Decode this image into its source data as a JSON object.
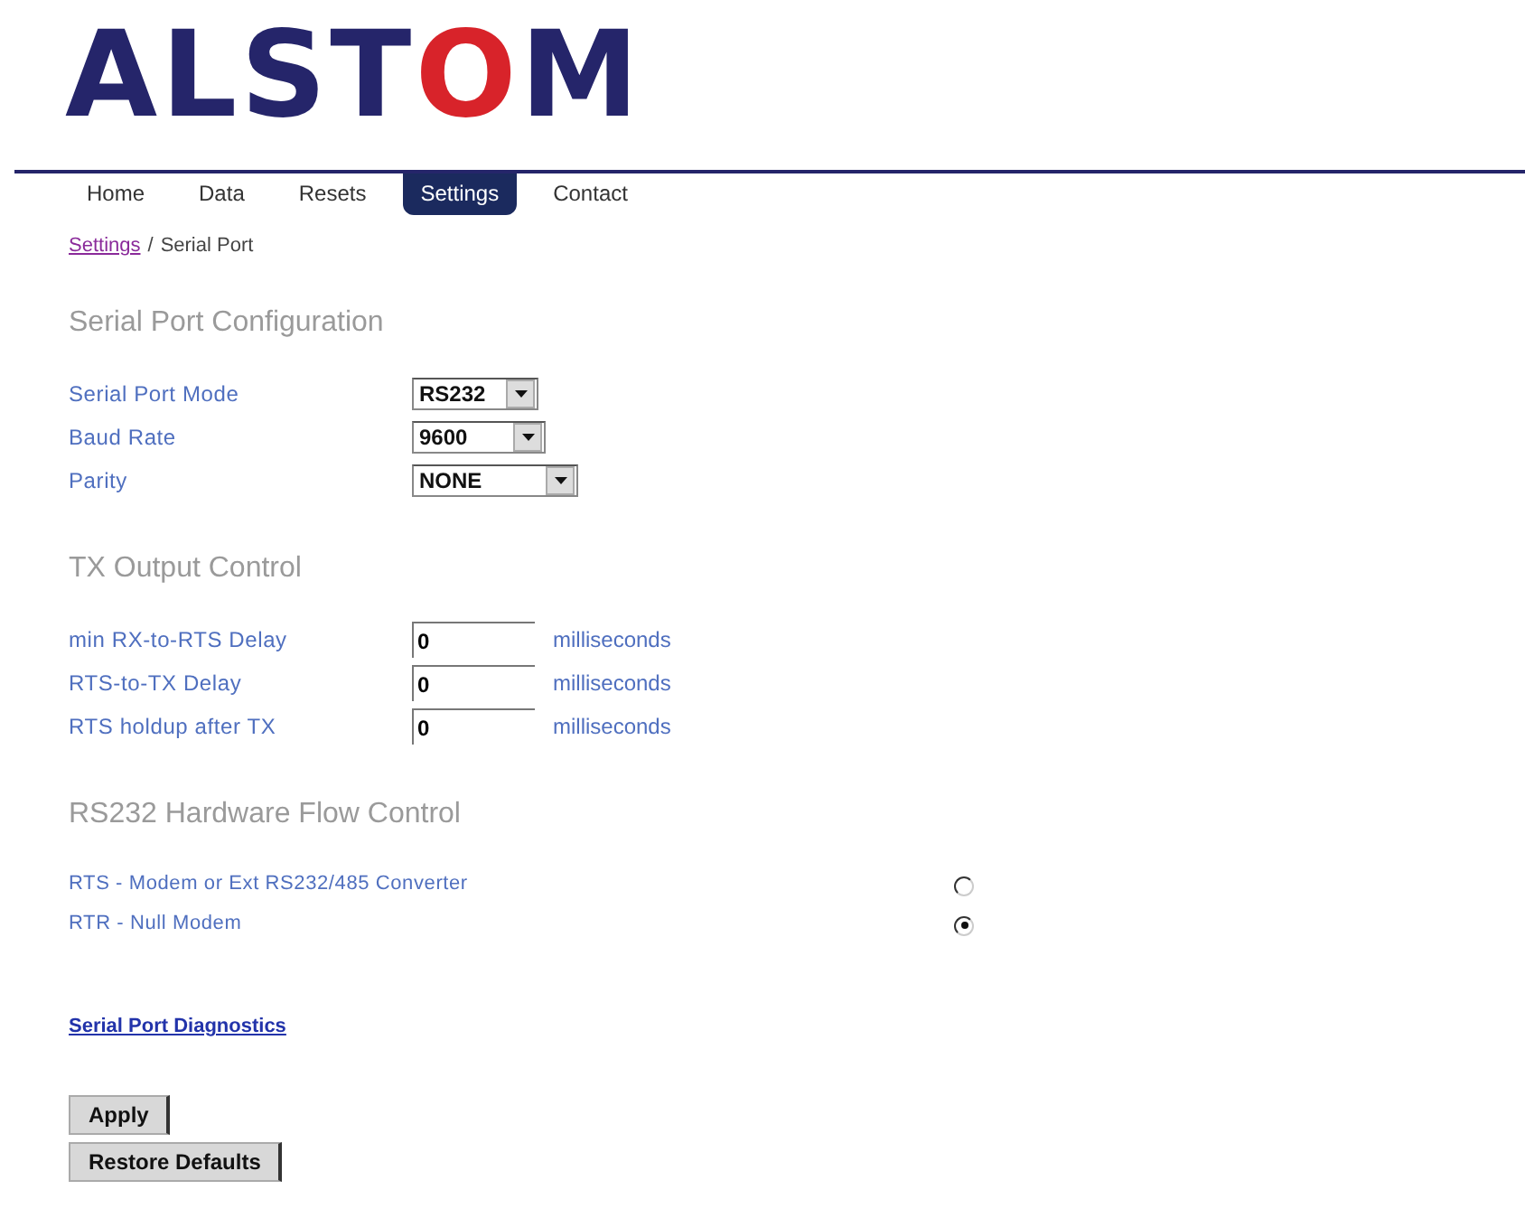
{
  "logo": {
    "parts": [
      "ALST",
      "O",
      "M"
    ]
  },
  "tabs": [
    {
      "label": "Home",
      "selected": false
    },
    {
      "label": "Data",
      "selected": false
    },
    {
      "label": "Resets",
      "selected": false
    },
    {
      "label": "Settings",
      "selected": true
    },
    {
      "label": "Contact",
      "selected": false
    }
  ],
  "breadcrumb": {
    "link": "Settings",
    "separator": "/",
    "current": "Serial Port"
  },
  "sections": [
    {
      "title": "Serial Port Configuration",
      "rows": [
        {
          "kind": "select",
          "label": "Serial Port Mode",
          "value": "RS232"
        },
        {
          "kind": "select",
          "label": "Baud Rate",
          "value": "9600"
        },
        {
          "kind": "select",
          "label": "Parity",
          "value": "NONE"
        }
      ]
    },
    {
      "title": "TX Output Control",
      "rows": [
        {
          "kind": "number",
          "label": "min RX-to-RTS Delay",
          "value": "0",
          "unit": "milliseconds"
        },
        {
          "kind": "number",
          "label": "RTS-to-TX Delay",
          "value": "0",
          "unit": "milliseconds"
        },
        {
          "kind": "number",
          "label": "RTS holdup after TX",
          "value": "0",
          "unit": "milliseconds"
        }
      ]
    },
    {
      "title": "RS232 Hardware Flow Control",
      "rows": [
        {
          "kind": "radio",
          "label": "RTS - Modem or Ext RS232/485 Converter",
          "selected": false
        },
        {
          "kind": "radio",
          "label": "RTR - Null Modem",
          "selected": true
        }
      ]
    }
  ],
  "diagnostics_link": "Serial Port Diagnostics",
  "buttons": [
    "Apply",
    "Restore Defaults"
  ]
}
